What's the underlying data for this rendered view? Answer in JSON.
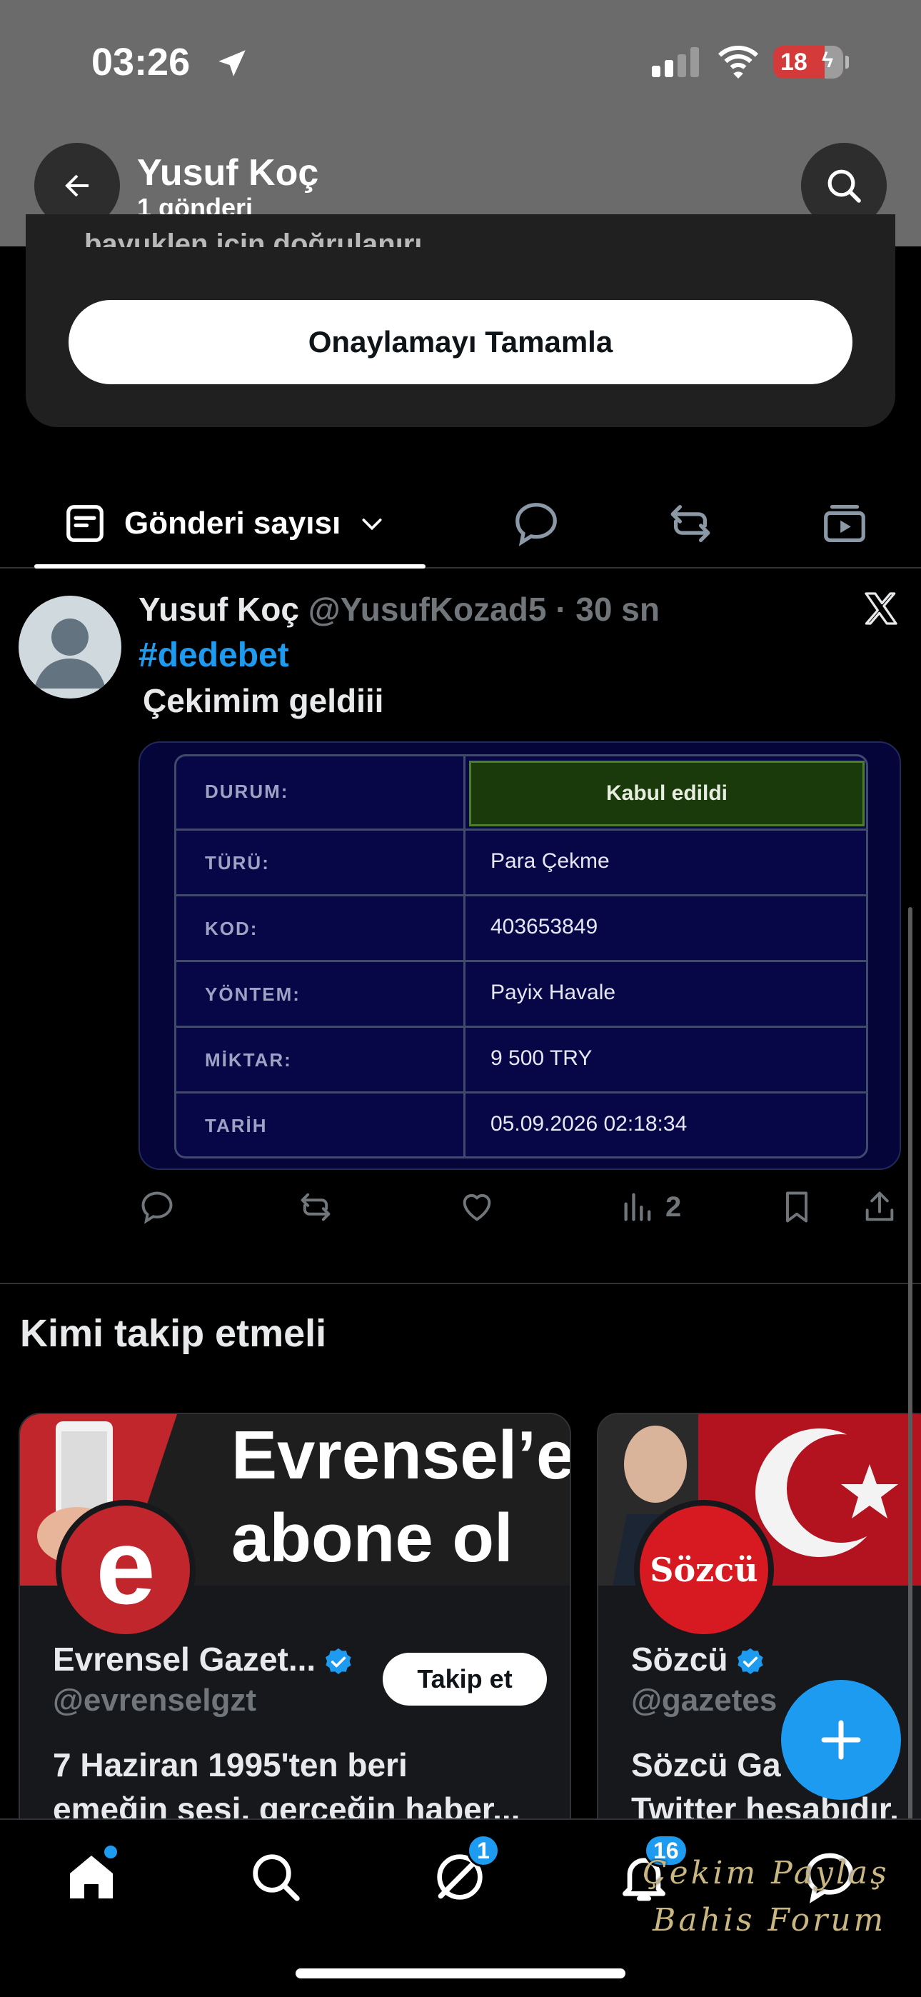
{
  "status_bar": {
    "time": "03:26",
    "battery": "18"
  },
  "header": {
    "name": "Yusuf Koç",
    "posts_count": "1 gönderi"
  },
  "verification": {
    "partial_text": "bayuklen için doğrulanırı",
    "button": "Onaylamayı Tamamla"
  },
  "tabs": {
    "active_label": "Gönderi sayısı"
  },
  "post": {
    "author": "Yusuf Koç",
    "handle": "@YusufKozad5",
    "separator": "·",
    "time": "30 sn",
    "hashtag": "#dedebet",
    "text": "Çekimim geldiii",
    "views": "2",
    "table": [
      {
        "key": "DURUM:",
        "value": "Kabul edildi"
      },
      {
        "key": "TÜRÜ:",
        "value": "Para Çekme"
      },
      {
        "key": "KOD:",
        "value": "403653849"
      },
      {
        "key": "YÖNTEM:",
        "value": "Payix Havale"
      },
      {
        "key": "MİKTAR:",
        "value": "9 500 TRY"
      },
      {
        "key": "TARİH",
        "value": "05.09.2026 02:18:34"
      }
    ]
  },
  "who_to_follow": {
    "title": "Kimi takip etmeli",
    "cards": [
      {
        "banner_text_1": "Evrensel’e",
        "banner_text_2": "abone ol",
        "logo_letter": "e",
        "name": "Evrensel Gazet...",
        "handle": "@evrenselgzt",
        "bio_1": "7 Haziran 1995'ten beri",
        "bio_2": "emeğin sesi, gerçeğin haber...",
        "follow_label": "Takip et"
      },
      {
        "logo_text": "Sözcü",
        "name": "Sözcü",
        "handle": "@gazetes",
        "bio_1": "Sözcü Ga",
        "bio_2": "Twitter hesabıdır."
      }
    ]
  },
  "bottom_nav": {
    "messages_badge": "1",
    "notifications_badge": "16"
  },
  "watermark": {
    "line1": "Çekim Paylaş",
    "line2": "Bahis Forum"
  },
  "colors": {
    "accent": "#1d9bf0",
    "header_bg": "#6b6b6b",
    "accepted_bg": "#1a3a0c"
  }
}
